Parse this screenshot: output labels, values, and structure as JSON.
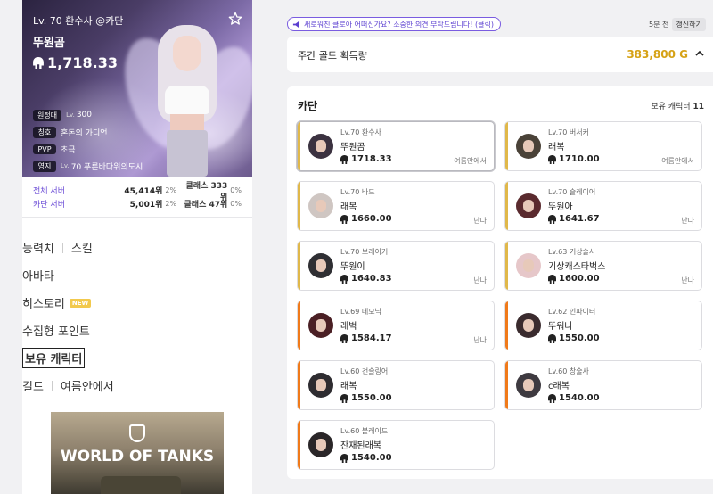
{
  "profile": {
    "level_line": "Lv. 70 환수사 @카단",
    "name": "뚜원곰",
    "item_level": "1,718.33",
    "tags": [
      {
        "tag": "원정대",
        "small": "Lv.",
        "value": "300"
      },
      {
        "tag": "칭호",
        "small": "",
        "value": "혼돈의 가디언"
      },
      {
        "tag": "PVP",
        "small": "",
        "value": "초극"
      },
      {
        "tag": "영지",
        "small": "Lv.",
        "value": "70 푸른바다위의도시"
      }
    ]
  },
  "ranks": [
    {
      "label": "전체 서버",
      "value": "45,414위",
      "pct": "2%",
      "class": "클래스 333위",
      "class_pct": "0%"
    },
    {
      "label": "카단 서버",
      "value": "5,001위",
      "pct": "2%",
      "class": "클래스 47위",
      "class_pct": "0%"
    }
  ],
  "menu": {
    "stats": "능력치",
    "skills": "스킬",
    "avatar": "아바타",
    "history": "히스토리",
    "new_badge": "NEW",
    "collection": "수집형 포인트",
    "owned_chars": "보유 캐릭터",
    "guild": "길드",
    "guild_name": "여름안에서"
  },
  "ad": {
    "logo": "WORLD OF TANKS"
  },
  "notice": {
    "text": "새로워진 클로아 어떠신가요? 소중한 의견 부탁드립니다! (클릭)"
  },
  "updated": {
    "time": "5분 전",
    "button": "갱신하기"
  },
  "gold": {
    "title": "주간 골드 획득량",
    "value": "383,800 G"
  },
  "server": {
    "name": "카단",
    "owned_label": "보유 캐릭터",
    "owned_count": "11"
  },
  "characters": [
    {
      "cls": "Lv.70 환수사",
      "name": "뚜원곰",
      "score": "1718.33",
      "loc": "여름안에서",
      "bar": "#e0b84a",
      "selected": true,
      "av": "#3b3240"
    },
    {
      "cls": "Lv.70 버서커",
      "name": "래복",
      "score": "1710.00",
      "loc": "여름안에서",
      "bar": "#e0b84a",
      "selected": false,
      "av": "#4a4238"
    },
    {
      "cls": "Lv.70 바드",
      "name": "래복",
      "score": "1660.00",
      "loc": "난나",
      "bar": "#e0b84a",
      "selected": false,
      "av": "#cfc6c2"
    },
    {
      "cls": "Lv.70 슬레이어",
      "name": "뚜원아",
      "score": "1641.67",
      "loc": "난나",
      "bar": "#e0b84a",
      "selected": false,
      "av": "#5a2a2e"
    },
    {
      "cls": "Lv.70 브레이커",
      "name": "뚜원이",
      "score": "1640.83",
      "loc": "난나",
      "bar": "#e0b84a",
      "selected": false,
      "av": "#2f2f33"
    },
    {
      "cls": "Lv.63 기상술사",
      "name": "기상캐스타벅스",
      "score": "1600.00",
      "loc": "난나",
      "bar": "#e0b84a",
      "selected": false,
      "av": "#e6c7c9"
    },
    {
      "cls": "Lv.69 데모닉",
      "name": "래벅",
      "score": "1584.17",
      "loc": "난나",
      "bar": "#f07a1a",
      "selected": false,
      "av": "#4a1f24"
    },
    {
      "cls": "Lv.62 인파이터",
      "name": "뚜워나",
      "score": "1550.00",
      "loc": "",
      "bar": "#f07a1a",
      "selected": false,
      "av": "#3a2b2e"
    },
    {
      "cls": "Lv.60 건슬링어",
      "name": "래복",
      "score": "1550.00",
      "loc": "",
      "bar": "#f07a1a",
      "selected": false,
      "av": "#2e2c30"
    },
    {
      "cls": "Lv.60 창술사",
      "name": "c래복",
      "score": "1540.00",
      "loc": "",
      "bar": "#f07a1a",
      "selected": false,
      "av": "#3e3a40"
    },
    {
      "cls": "Lv.60 블레이드",
      "name": "잔재된래복",
      "score": "1540.00",
      "loc": "",
      "bar": "#f07a1a",
      "selected": false,
      "av": "#2a2628"
    }
  ]
}
